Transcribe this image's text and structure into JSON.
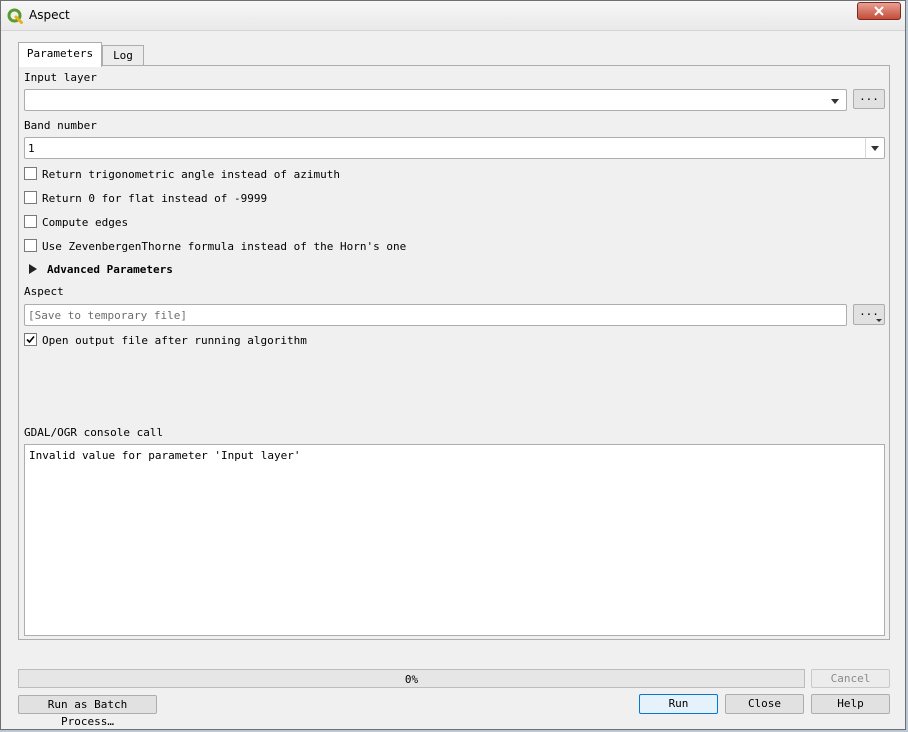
{
  "window": {
    "title": "Aspect",
    "close_icon": "close-icon"
  },
  "tabs": [
    {
      "label": "Parameters"
    },
    {
      "label": "Log"
    }
  ],
  "params": {
    "input_layer": {
      "label": "Input layer",
      "value": "",
      "browse_label": "..."
    },
    "band_number": {
      "label": "Band number",
      "value": "1"
    },
    "checkboxes": [
      {
        "label": "Return trigonometric angle instead of azimuth",
        "checked": false
      },
      {
        "label": "Return 0 for flat instead of -9999",
        "checked": false
      },
      {
        "label": "Compute edges",
        "checked": false
      },
      {
        "label": "Use ZevenbergenThorne formula instead of the Horn's one",
        "checked": false
      }
    ],
    "advanced": {
      "label": "Advanced Parameters"
    },
    "output": {
      "label": "Aspect",
      "placeholder": "[Save to temporary file]",
      "browse_label": "..."
    },
    "open_output": {
      "label": "Open output file after running algorithm",
      "checked": true
    },
    "console": {
      "label": "GDAL/OGR console call",
      "text": "Invalid value for parameter 'Input layer'"
    }
  },
  "progress": {
    "value": 0,
    "text": "0%"
  },
  "buttons": {
    "cancel": "Cancel",
    "batch": "Run as Batch Process…",
    "run": "Run",
    "close": "Close",
    "help": "Help"
  }
}
